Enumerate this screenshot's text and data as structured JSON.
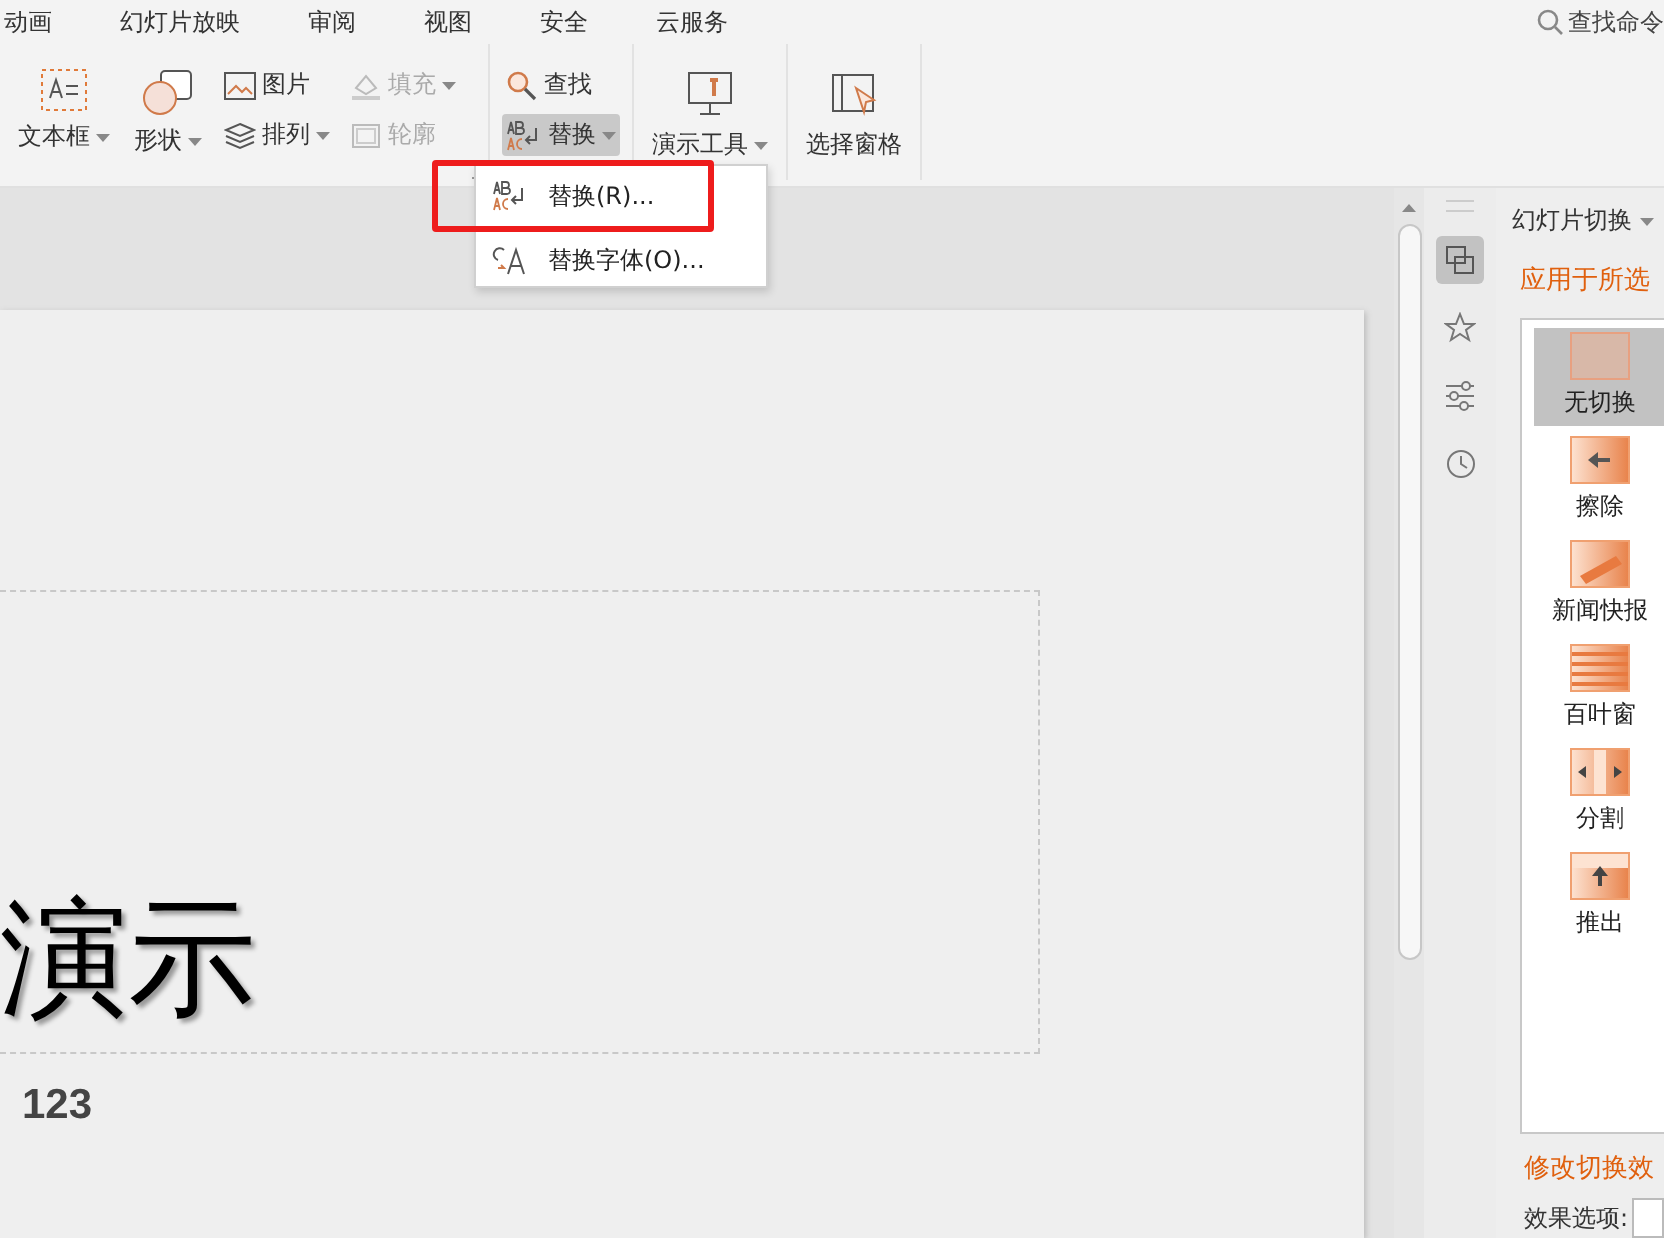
{
  "menu_tabs": [
    "动画",
    "幻灯片放映",
    "审阅",
    "视图",
    "安全",
    "云服务"
  ],
  "search_command": {
    "label": "查找命令"
  },
  "ribbon": {
    "text_box": "文本框",
    "shape": "形状",
    "picture": "图片",
    "arrange": "排列",
    "fill": {
      "label": "填充",
      "disabled": true
    },
    "outline": {
      "label": "轮廓",
      "disabled": true
    },
    "find": "查找",
    "replace": {
      "label": "替换",
      "pressed": true
    },
    "presentation_tools": "演示工具",
    "selection_pane": "选择窗格"
  },
  "dropdown": {
    "items": [
      {
        "label": "替换(R)...",
        "kind": "replace"
      },
      {
        "label": "替换字体(O)...",
        "kind": "font"
      }
    ]
  },
  "slide": {
    "title": "演示",
    "subtitle": "123"
  },
  "side_icons": [
    {
      "kind": "transition",
      "selected": true
    },
    {
      "kind": "animation",
      "selected": false
    },
    {
      "kind": "settings",
      "selected": false
    },
    {
      "kind": "history",
      "selected": false
    }
  ],
  "panel": {
    "title": "幻灯片切换",
    "apply_link": "应用于所选",
    "transitions": [
      {
        "label": "无切换",
        "kind": "none",
        "selected": true
      },
      {
        "label": "擦除",
        "kind": "wipe",
        "selected": false
      },
      {
        "label": "新闻快报",
        "kind": "news",
        "selected": false
      },
      {
        "label": "百叶窗",
        "kind": "blinds",
        "selected": false
      },
      {
        "label": "分割",
        "kind": "split",
        "selected": false
      },
      {
        "label": "推出",
        "kind": "push",
        "selected": false
      }
    ],
    "modify_heading": "修改切换效",
    "effect_options_label": "效果选项:"
  }
}
